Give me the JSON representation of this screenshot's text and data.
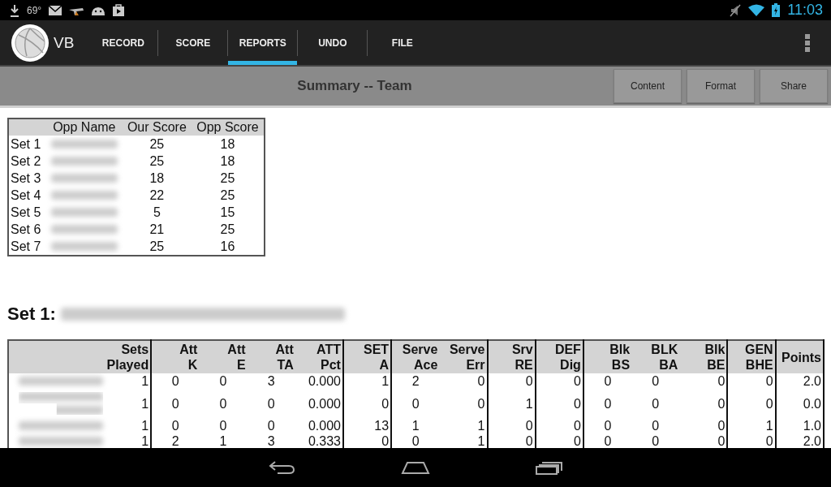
{
  "status_bar": {
    "temperature": "69°",
    "time": "11:03"
  },
  "action_bar": {
    "app_label": "VB",
    "tabs": [
      {
        "label": "RECORD",
        "selected": false
      },
      {
        "label": "SCORE",
        "selected": false
      },
      {
        "label": "REPORTS",
        "selected": true
      },
      {
        "label": "UNDO",
        "selected": false
      },
      {
        "label": "FILE",
        "selected": false
      }
    ]
  },
  "toolbar": {
    "title": "Summary -- Team",
    "buttons": [
      "Content",
      "Format",
      "Share"
    ]
  },
  "sets_table": {
    "columns": [
      "Opp Name",
      "Our Score",
      "Opp Score"
    ],
    "rows": [
      {
        "label": "Set 1",
        "opp_redacted": true,
        "our": "25",
        "opp": "18"
      },
      {
        "label": "Set 2",
        "opp_redacted": true,
        "our": "25",
        "opp": "18"
      },
      {
        "label": "Set 3",
        "opp_redacted": true,
        "our": "18",
        "opp": "25"
      },
      {
        "label": "Set 4",
        "opp_redacted": true,
        "our": "22",
        "opp": "25"
      },
      {
        "label": "Set 5",
        "opp_redacted": true,
        "our": "5",
        "opp": "15"
      },
      {
        "label": "Set 6",
        "opp_redacted": true,
        "our": "21",
        "opp": "25"
      },
      {
        "label": "Set 7",
        "opp_redacted": true,
        "our": "25",
        "opp": "16"
      }
    ]
  },
  "set_heading": {
    "label": "Set 1:",
    "detail_redacted": true
  },
  "stats_table": {
    "columns": [
      {
        "lines": [
          "Sets",
          "Played"
        ],
        "divider": true
      },
      {
        "lines": [
          "Att",
          "K"
        ],
        "divider": false
      },
      {
        "lines": [
          "Att",
          "E"
        ],
        "divider": false
      },
      {
        "lines": [
          "Att",
          "TA"
        ],
        "divider": false
      },
      {
        "lines": [
          "ATT",
          "Pct"
        ],
        "divider": true
      },
      {
        "lines": [
          "SET",
          "A"
        ],
        "divider": true
      },
      {
        "lines": [
          "Serve",
          "Ace"
        ],
        "divider": false
      },
      {
        "lines": [
          "Serve",
          "Err"
        ],
        "divider": true
      },
      {
        "lines": [
          "Srv",
          "RE"
        ],
        "divider": true
      },
      {
        "lines": [
          "DEF",
          "Dig"
        ],
        "divider": true
      },
      {
        "lines": [
          "Blk",
          "BS"
        ],
        "divider": false
      },
      {
        "lines": [
          "BLK",
          "BA"
        ],
        "divider": false
      },
      {
        "lines": [
          "Blk",
          "BE"
        ],
        "divider": true
      },
      {
        "lines": [
          "GEN",
          "BHE"
        ],
        "divider": true
      },
      {
        "lines": [
          "Points"
        ],
        "divider": true
      }
    ],
    "rows": [
      {
        "name_redacted": true,
        "name_wraps": false,
        "values": [
          "1",
          "0",
          "0",
          "3",
          "0.000",
          "1",
          "2",
          "0",
          "0",
          "0",
          "0",
          "0",
          "0",
          "0",
          "2.0"
        ]
      },
      {
        "name_redacted": true,
        "name_wraps": true,
        "values": [
          "1",
          "0",
          "0",
          "0",
          "0.000",
          "0",
          "0",
          "0",
          "1",
          "0",
          "0",
          "0",
          "0",
          "0",
          "0.0"
        ]
      },
      {
        "name_redacted": true,
        "name_wraps": false,
        "values": [
          "1",
          "0",
          "0",
          "0",
          "0.000",
          "13",
          "1",
          "1",
          "0",
          "0",
          "0",
          "0",
          "0",
          "1",
          "1.0"
        ]
      },
      {
        "name_redacted": true,
        "name_wraps": false,
        "values": [
          "1",
          "2",
          "1",
          "3",
          "0.333",
          "0",
          "0",
          "1",
          "0",
          "0",
          "0",
          "0",
          "0",
          "0",
          "2.0"
        ]
      }
    ]
  }
}
